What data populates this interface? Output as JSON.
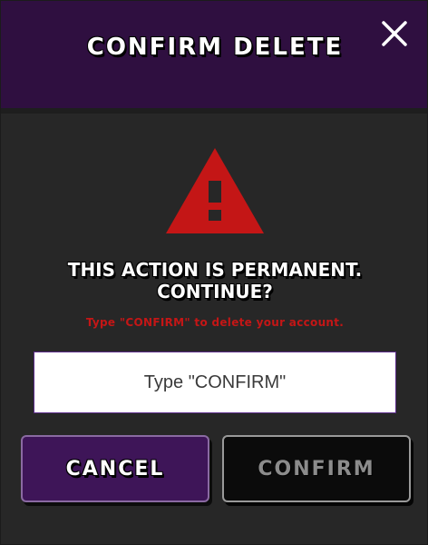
{
  "dialog": {
    "title": "CONFIRM DELETE",
    "close_icon": "close-icon",
    "warning_icon": "warning-triangle-icon",
    "warning_color": "#c41616",
    "message_line1": "THIS ACTION IS PERMANENT.",
    "message_line2": "CONTINUE?",
    "hint": "Type \"CONFIRM\" to delete your account.",
    "input": {
      "value": "",
      "placeholder": "Type \"CONFIRM\""
    },
    "buttons": {
      "cancel_label": "CANCEL",
      "confirm_label": "CONFIRM"
    }
  }
}
